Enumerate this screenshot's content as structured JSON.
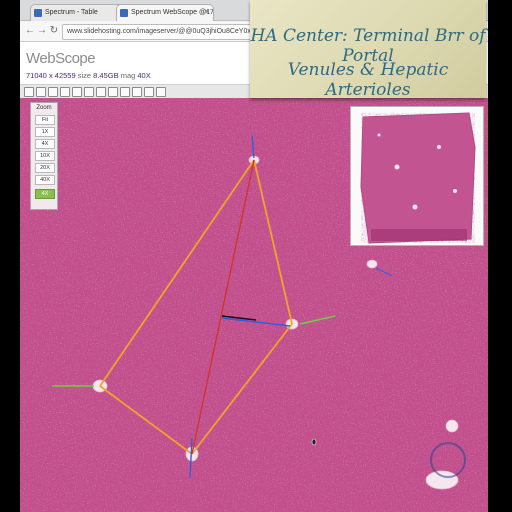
{
  "browser": {
    "tabs": [
      {
        "label": "Spectrum - Table"
      },
      {
        "label": "Spectrum WebScope @17"
      }
    ],
    "url": "www.slidehosting.com/imageserver/@@0uQ3jhiOu8CeY0xLoEckrI9X9dYxUP"
  },
  "app": {
    "logo": "WebScope",
    "dimensions": "71040 x 42559",
    "size_label": "size",
    "size_value": "8.45GB",
    "mag_label": "mag",
    "mag_value": "40X"
  },
  "zoom": {
    "title": "Zoom",
    "levels": [
      "Fit",
      "1X",
      "4X",
      "10X",
      "20X",
      "40X",
      "4X"
    ],
    "selected": "4X"
  },
  "overlay": {
    "line1": "HA Center: Terminal Brr of Portal",
    "line2": "Venules & Hepatic Arterioles"
  },
  "colors": {
    "tissue": "#c2508c",
    "annotation_orange": "#f0a32a",
    "annotation_red": "#d2342a",
    "annotation_blue": "#2f5fe0",
    "annotation_green": "#6bd23a",
    "banner_text": "#2d6a84"
  }
}
